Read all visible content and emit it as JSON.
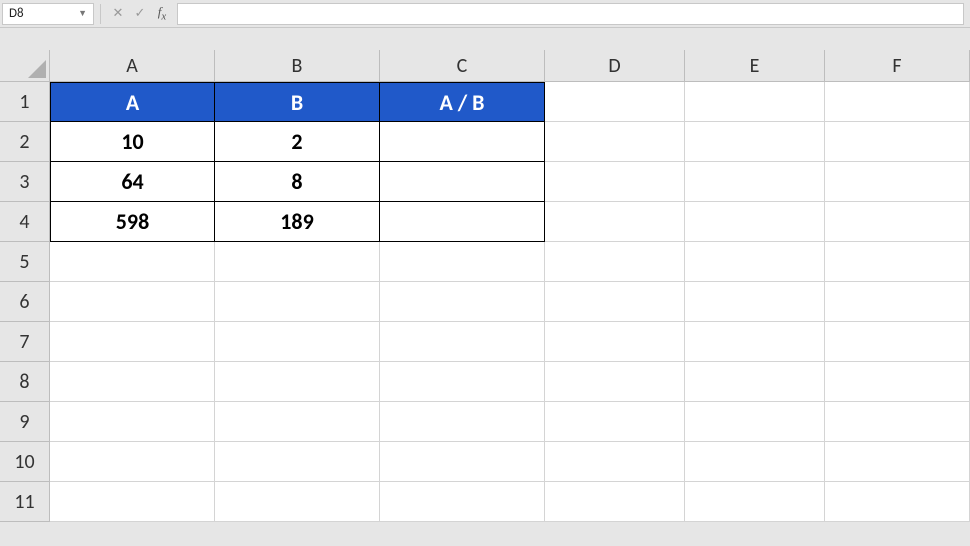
{
  "namebox": {
    "value": "D8"
  },
  "formula_input": {
    "value": ""
  },
  "columns": [
    "A",
    "B",
    "C",
    "D",
    "E",
    "F"
  ],
  "row_labels": [
    "1",
    "2",
    "3",
    "4",
    "5",
    "6",
    "7",
    "8",
    "9",
    "10",
    "11"
  ],
  "table": {
    "headers": {
      "A": "A",
      "B": "B",
      "C": "A / B"
    },
    "rows": [
      {
        "A": "10",
        "B": "2",
        "C": ""
      },
      {
        "A": "64",
        "B": "8",
        "C": ""
      },
      {
        "A": "598",
        "B": "189",
        "C": ""
      }
    ]
  },
  "chart_data": {
    "type": "table",
    "title": "",
    "columns": [
      "A",
      "B",
      "A / B"
    ],
    "rows": [
      [
        10,
        2,
        null
      ],
      [
        64,
        8,
        null
      ],
      [
        598,
        189,
        null
      ]
    ]
  }
}
